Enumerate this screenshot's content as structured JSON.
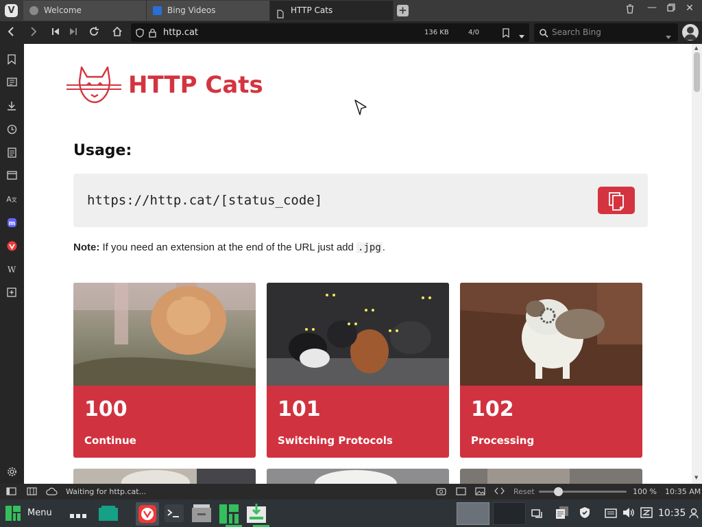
{
  "tabs": [
    {
      "label": "Welcome"
    },
    {
      "label": "Bing Videos"
    },
    {
      "label": "HTTP Cats"
    }
  ],
  "address": {
    "url": "http.cat",
    "page_size": "136 KB",
    "counter": "4/0"
  },
  "search": {
    "placeholder": "Search Bing"
  },
  "page": {
    "logo_text": "HTTP Cats",
    "usage_heading": "Usage:",
    "usage_code": "https://http.cat/[status_code]",
    "note_label": "Note:",
    "note_text": " If you need an extension at the end of the URL just add ",
    "note_code": ".jpg",
    "note_end": ".",
    "cards": [
      {
        "code": "100",
        "label": "Continue"
      },
      {
        "code": "101",
        "label": "Switching Protocols"
      },
      {
        "code": "102",
        "label": "Processing"
      }
    ]
  },
  "statusbar": {
    "status": "Waiting for http.cat...",
    "reset": "Reset",
    "zoom": "100 %",
    "time": "10:35 AM",
    "zoom_level": 1.0
  },
  "taskbar": {
    "menu_label": "Menu",
    "clock": "10:35"
  },
  "colors": {
    "brand_red": "#d4343f",
    "browser_dark": "#262626",
    "taskbar": "#2e3338",
    "manjaro_green": "#35bf5c"
  }
}
